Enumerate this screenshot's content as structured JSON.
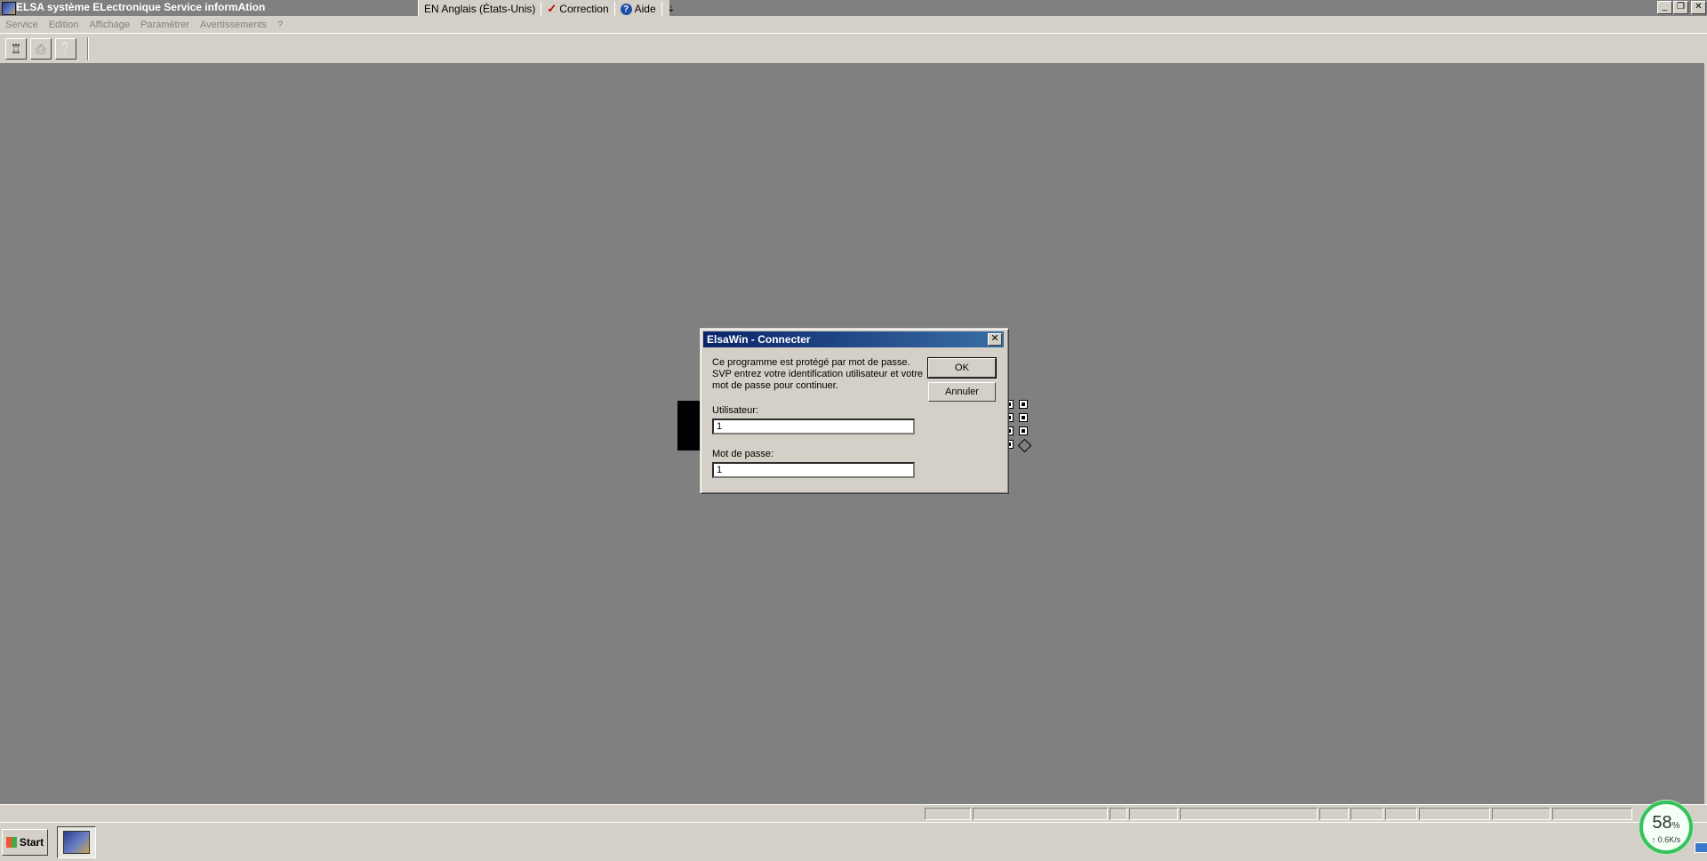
{
  "window": {
    "title": "ELSA système ELectronique Service informAtion",
    "controls": [
      "minimize",
      "restore",
      "close"
    ]
  },
  "langbar": {
    "language": "EN Anglais (États-Unis)",
    "correction": "Correction",
    "help": "Aide",
    "correction_icon": "correction-icon",
    "help_icon": "help-icon"
  },
  "menu": {
    "items": [
      "Service",
      "Edition",
      "Affichage",
      "Paramétrer",
      "Avertissements",
      "?"
    ]
  },
  "toolbar": {
    "buttons": [
      "exit-icon",
      "print-icon",
      "help-pointer-icon"
    ]
  },
  "dialog": {
    "title": "ElsaWin - Connecter",
    "message_line1": "Ce programme est protégé par mot de passe.",
    "message_line2": "SVP entrez votre identification utilisateur et votre",
    "message_line3": "mot de passe pour continuer.",
    "user_label": "Utilisateur:",
    "user_value": "1",
    "password_label": "Mot de passe:",
    "password_value": "1",
    "ok_label": "OK",
    "cancel_label": "Annuler"
  },
  "taskbar": {
    "start_label": "Start"
  },
  "network_meter": {
    "percent": "58",
    "percent_unit": "%",
    "speed": "↑ 0.6K/s",
    "ring_color": "#35c25a"
  }
}
